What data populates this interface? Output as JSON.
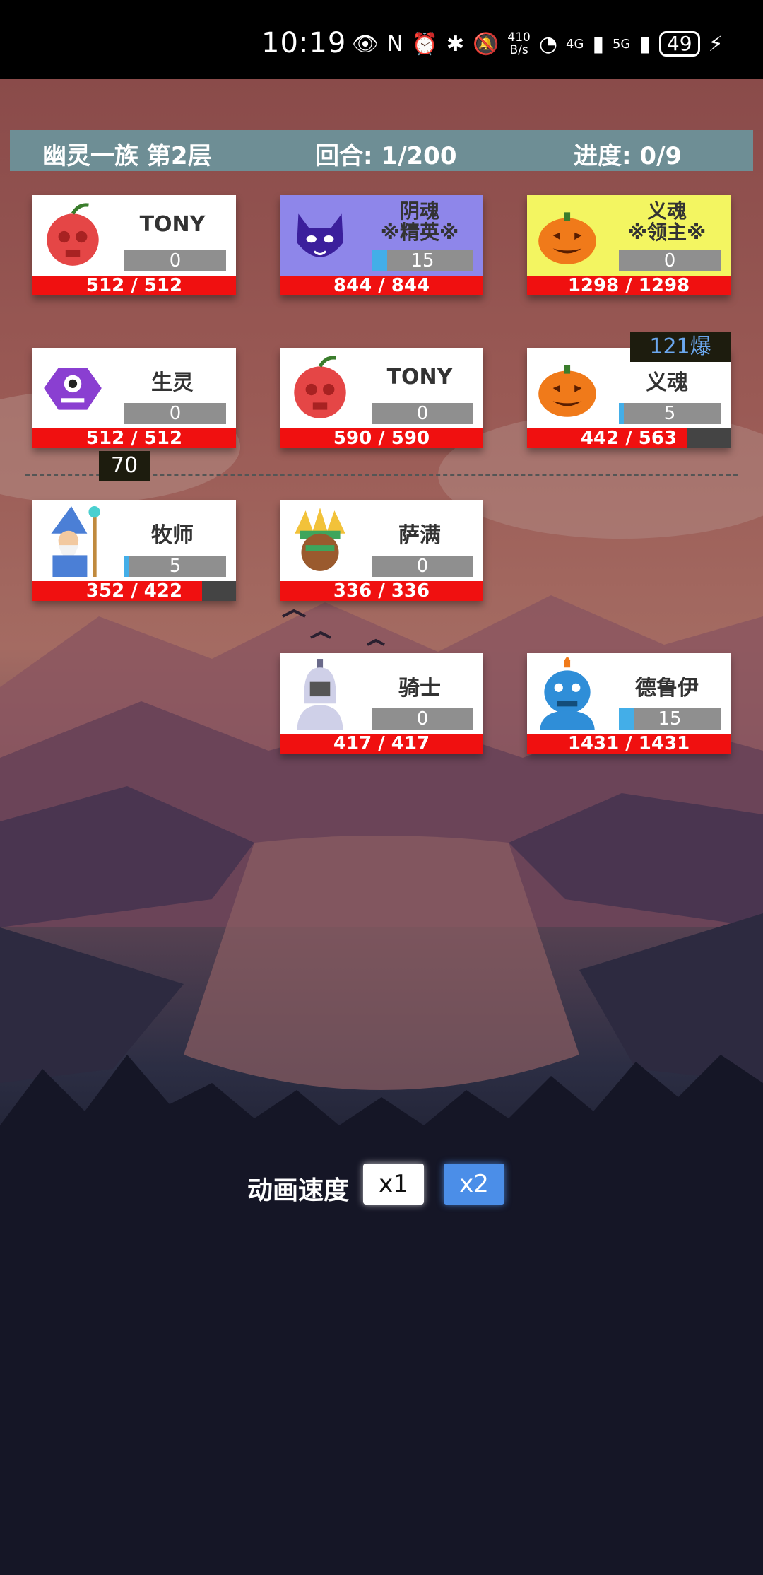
{
  "status_bar": {
    "time": "10:19",
    "net_speed_top": "410",
    "net_speed_bottom": "B/s",
    "signal1": "4G",
    "signal2": "5G",
    "battery": "49"
  },
  "header": {
    "level": "幽灵一族 第2层",
    "round": "回合: 1/200",
    "progress": "进度: 0/9"
  },
  "enemies": [
    {
      "name": "TONY",
      "energy": "0",
      "energy_pct": 0,
      "hp": "512 / 512",
      "hp_pct": 100,
      "avatar": "skull-apple-icon",
      "style": "normal"
    },
    {
      "name": "阴魂",
      "name2": "※精英※",
      "energy": "15",
      "energy_pct": 15,
      "hp": "844 / 844",
      "hp_pct": 100,
      "avatar": "shadow-demon-icon",
      "style": "elite"
    },
    {
      "name": "义魂",
      "name2": "※领主※",
      "energy": "0",
      "energy_pct": 0,
      "hp": "1298 / 1298",
      "hp_pct": 100,
      "avatar": "pumpkin-icon",
      "style": "boss"
    },
    {
      "name": "生灵",
      "energy": "0",
      "energy_pct": 0,
      "hp": "512 / 512",
      "hp_pct": 100,
      "avatar": "purple-eye-monster-icon",
      "style": "normal"
    },
    {
      "name": "TONY",
      "energy": "0",
      "energy_pct": 0,
      "hp": "590 / 590",
      "hp_pct": 100,
      "avatar": "skull-apple-icon",
      "style": "normal"
    },
    {
      "name": "义魂",
      "energy": "5",
      "energy_pct": 5,
      "hp": "442 / 563",
      "hp_pct": 78.5,
      "avatar": "pumpkin-icon",
      "style": "normal"
    }
  ],
  "heroes": [
    {
      "name": "牧师",
      "energy": "5",
      "energy_pct": 5,
      "hp": "352 / 422",
      "hp_pct": 83.4,
      "avatar": "wizard-icon"
    },
    {
      "name": "萨满",
      "energy": "0",
      "energy_pct": 0,
      "hp": "336 / 336",
      "hp_pct": 100,
      "avatar": "shaman-icon"
    },
    {
      "name": "骑士",
      "energy": "0",
      "energy_pct": 0,
      "hp": "417 / 417",
      "hp_pct": 100,
      "avatar": "knight-icon"
    },
    {
      "name": "德鲁伊",
      "energy": "15",
      "energy_pct": 15,
      "hp": "1431 / 1431",
      "hp_pct": 100,
      "avatar": "blue-ogre-icon"
    }
  ],
  "damage_popups": {
    "enemy_crit": "121爆",
    "hero_damage": "70"
  },
  "speed_control": {
    "label": "动画速度",
    "x1": "x1",
    "x2": "x2",
    "selected": "x2"
  },
  "colors": {
    "hp_red": "#f01010",
    "energy_blue": "#43aee8",
    "header_bg": "#6e8e95",
    "elite_bg": "#8e86ea",
    "boss_bg": "#f3f561"
  }
}
